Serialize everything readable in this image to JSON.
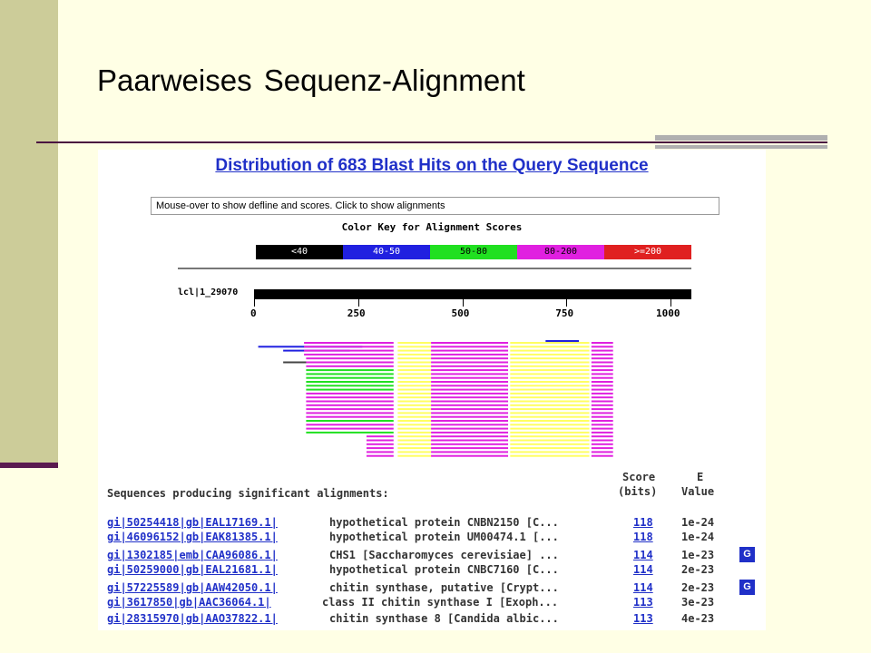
{
  "slide": {
    "title": "Paarweises Sequenz-Alignment"
  },
  "blast": {
    "title": "Distribution of 683 Blast Hits on the Query Sequence",
    "mouseover_text": "Mouse-over to show defline and scores. Click to show alignments",
    "color_key_title": "Color Key for Alignment Scores",
    "color_key": [
      {
        "label": "<40",
        "color": "#000000",
        "text_color": "#ffffff"
      },
      {
        "label": "40-50",
        "color": "#2020e0",
        "text_color": "#ffffff"
      },
      {
        "label": "50-80",
        "color": "#20e020",
        "text_color": "#000000"
      },
      {
        "label": "80-200",
        "color": "#e020e0",
        "text_color": "#000000"
      },
      {
        "label": ">=200",
        "color": "#e02020",
        "text_color": "#ffffff"
      }
    ],
    "query_label": "lcl|1_29070",
    "query_length": 1050,
    "tick_labels": [
      "0",
      "250",
      "500",
      "750",
      "1000"
    ],
    "tick_values": [
      0,
      250,
      500,
      750,
      1000
    ],
    "hits": [
      {
        "start": 20,
        "end": 260,
        "color": "#2020e0"
      },
      {
        "start": 120,
        "end": 335,
        "color": "#e020e0"
      },
      {
        "start": 340,
        "end": 420,
        "color": "#ffff60"
      },
      {
        "start": 425,
        "end": 600,
        "color": "#e020e0"
      },
      {
        "start": 605,
        "end": 800,
        "color": "#ffff60"
      },
      {
        "start": 805,
        "end": 850,
        "color": "#e020e0"
      },
      {
        "start": 700,
        "end": 780,
        "color": "#2020e0"
      }
    ],
    "sequences_header": "Sequences producing significant alignments:",
    "col_score_1": "Score",
    "col_score_2": "(bits)",
    "col_e_1": "E",
    "col_e_2": "Value",
    "rows": [
      {
        "acc": "gi|50254418|gb|EAL17169.1|",
        "desc": "hypothetical protein CNBN2150 [C...",
        "score": "118",
        "evalue": "1e-24",
        "badge": ""
      },
      {
        "acc": "gi|46096152|gb|EAK81385.1|",
        "desc": "hypothetical protein UM00474.1 [...",
        "score": "118",
        "evalue": "1e-24",
        "badge": ""
      },
      {
        "acc": "gi|1302185|emb|CAA96086.1|",
        "desc": "CHS1 [Saccharomyces cerevisiae] ...",
        "score": "114",
        "evalue": "1e-23",
        "badge": "G"
      },
      {
        "acc": "gi|50259000|gb|EAL21681.1|",
        "desc": "hypothetical protein CNBC7160 [C...",
        "score": "114",
        "evalue": "2e-23",
        "badge": ""
      },
      {
        "acc": "gi|57225589|gb|AAW42050.1|",
        "desc": "chitin synthase, putative [Crypt...",
        "score": "114",
        "evalue": "2e-23",
        "badge": "G"
      },
      {
        "acc": "gi|3617850|gb|AAC36064.1|",
        "desc": "class II chitin synthase I [Exoph...",
        "score": "113",
        "evalue": "3e-23",
        "badge": ""
      },
      {
        "acc": "gi|28315970|gb|AAO37822.1|",
        "desc": "chitin synthase 8 [Candida albic...",
        "score": "113",
        "evalue": "4e-23",
        "badge": ""
      }
    ]
  }
}
